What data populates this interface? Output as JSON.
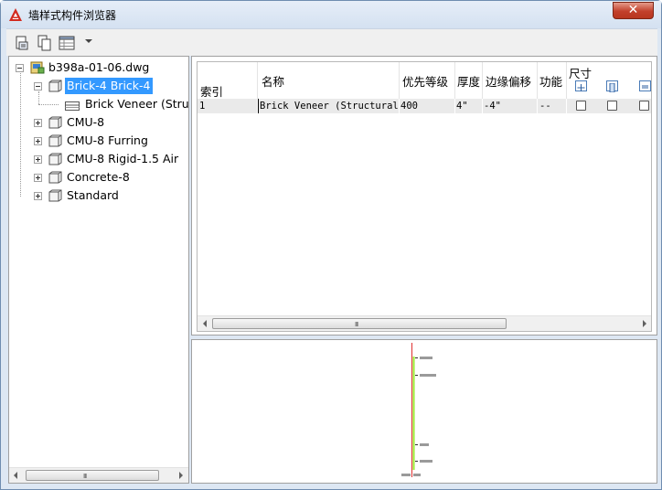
{
  "window": {
    "title": "墙样式构件浏览器",
    "close_label": "✕"
  },
  "toolbar": {
    "buttons": [
      "new-style-icon",
      "copy-icon",
      "table-view-icon"
    ]
  },
  "tree": {
    "root": "b398a-01-06.dwg",
    "items": [
      {
        "label": "Brick-4 Brick-4",
        "selected": true,
        "expanded": true
      },
      {
        "label": "Brick Veneer (Struc",
        "child": true
      },
      {
        "label": "CMU-8"
      },
      {
        "label": "CMU-8 Furring"
      },
      {
        "label": "CMU-8 Rigid-1.5 Air"
      },
      {
        "label": "Concrete-8"
      },
      {
        "label": "Standard"
      }
    ],
    "scroll_grip": "III"
  },
  "grid": {
    "headers": {
      "index": "索引",
      "name": "名称",
      "priority": "优先等级",
      "thickness": "厚度",
      "edge_offset": "边缘偏移",
      "function": "功能",
      "dimension": "尺寸"
    },
    "rows": [
      {
        "index": "1",
        "name": "Brick Veneer (Structural)",
        "priority": "400",
        "thickness": "4\"",
        "edge_offset": "-4\"",
        "function": "--"
      }
    ],
    "scroll_grip": "III"
  },
  "colors": {
    "selection": "#3399ff",
    "component_line": "#9be82f",
    "baseline": "#e03030"
  }
}
